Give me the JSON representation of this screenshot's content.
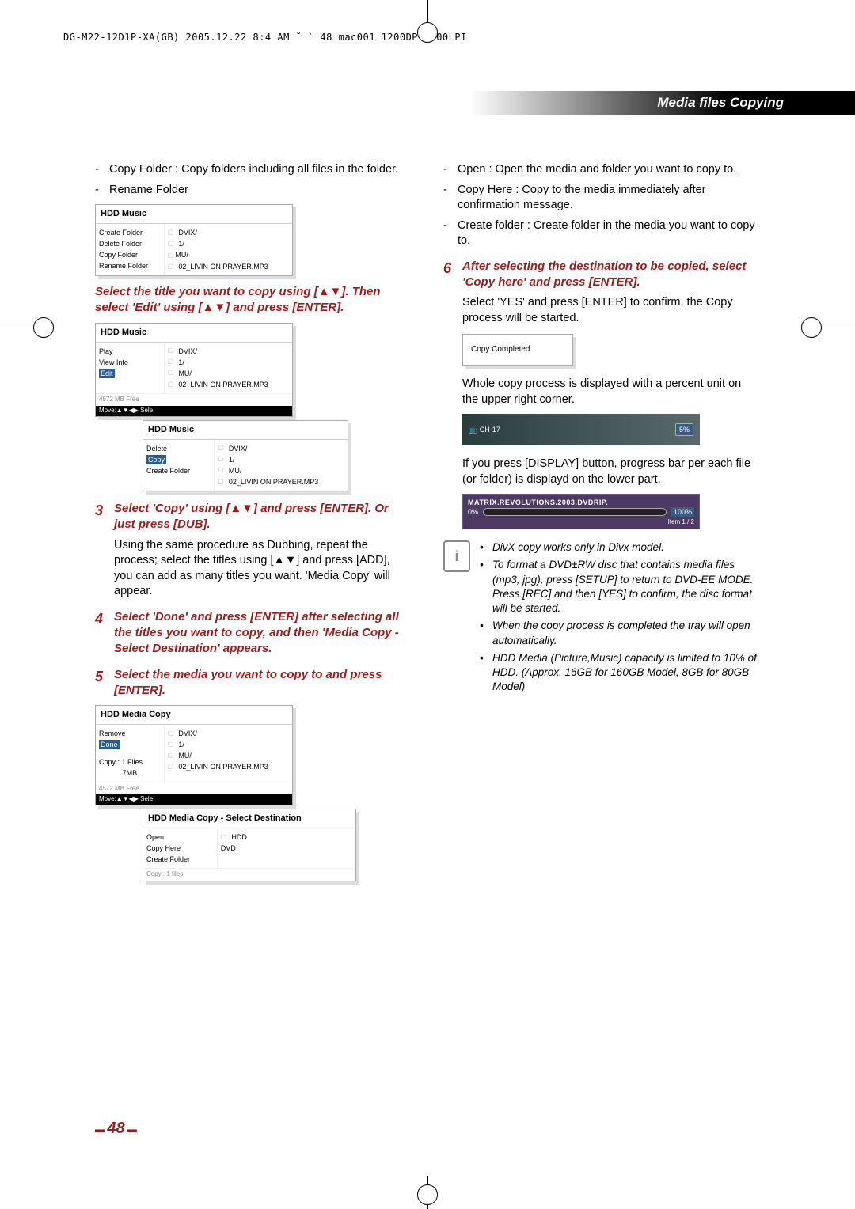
{
  "header_line": "DG-M22-12D1P-XA(GB)  2005.12.22 8:4 AM  ˘ ` 48   mac001  1200DPI 100LPI",
  "section_title": "Media files Copying",
  "left": {
    "b1": "Copy Folder : Copy folders including all files in the folder.",
    "b2": "Rename Folder",
    "ss1": {
      "title": "HDD Music",
      "menu": [
        "Create Folder",
        "Delete Folder",
        "Copy Folder",
        "Rename Folder"
      ],
      "hl": "MU/",
      "files": [
        "DVIX/",
        "1/",
        "MU/",
        "02_LIVIN ON PRAYER.MP3"
      ]
    },
    "emph1": "Select the title you want to copy using [▲▼]. Then select 'Edit' using  [▲▼] and press [ENTER].",
    "ss2": {
      "title": "HDD Music",
      "menu": [
        "Play",
        "View Info",
        "Edit"
      ],
      "hl": "Edit",
      "files": [
        "DVIX/",
        "1/",
        "MU/",
        "02_LIVIN ON PRAYER.MP3"
      ],
      "free": "4572 MB Free",
      "foot": "Move:▲▼◀▶  Sele"
    },
    "ss2b": {
      "title": "HDD Music",
      "menu": [
        "Delete",
        "Copy",
        "Create Folder"
      ],
      "hl": "Copy",
      "files": [
        "DVIX/",
        "1/",
        "MU/",
        "02_LIVIN ON PRAYER.MP3"
      ]
    },
    "step3": "Select 'Copy' using  [▲▼] and press [ENTER]. Or just press [DUB].",
    "p3": "Using the same procedure as Dubbing, repeat the process; select the titles using [▲▼] and press [ADD], you can add as many titles you want. 'Media Copy' will appear.",
    "step4": "Select 'Done' and press [ENTER] after selecting all the titles you want to copy, and then 'Media Copy - Select Destination' appears.",
    "step5": "Select the media you want to copy to and press [ENTER].",
    "ss3": {
      "title": "HDD Media Copy",
      "menu": [
        "Remove",
        "Done"
      ],
      "hl": "Done",
      "files": [
        "DVIX/",
        "1/",
        "MU/",
        "02_LIVIN ON PRAYER.MP3"
      ],
      "copy": "Copy : 1 Files",
      "size": "7MB",
      "free": "4572 MB Free",
      "foot": "Move:▲▼◀▶  Sele"
    },
    "ss3b": {
      "title": "HDD Media Copy - Select Destination",
      "menu": [
        "Open",
        "Copy Here",
        "Create Folder"
      ],
      "dest": [
        "HDD",
        "DVD"
      ],
      "hl": "DVD",
      "copy": "Copy : 1 files"
    }
  },
  "right": {
    "b1": "Open : Open the media and folder you want to copy to.",
    "b2": "Copy Here : Copy to the media immediately after confirmation message.",
    "b3": "Create folder : Create folder in the media you want to copy to.",
    "step6": "After selecting the destination to be copied, select 'Copy here' and press [ENTER].",
    "p6": "Select 'YES' and press [ENTER] to confirm, the Copy process will be started.",
    "dialog": "Copy Completed",
    "p7": "Whole copy process is displayed with a percent unit on the upper right corner.",
    "prog1": {
      "ch": "CH-17",
      "pct": "5%"
    },
    "p8": "If you press [DISPLAY] button, progress bar per each file (or folder) is displayd on the lower part.",
    "prog2": {
      "name": "MATRIX.REVOLUTIONS.2003.DVDRIP.",
      "pct_left": "0%",
      "pct_right": "100%",
      "item": "Item 1 / 2"
    },
    "notes": {
      "n1": "DivX copy works only in Divx model.",
      "n2": "To format a DVD±RW disc that contains media files (mp3, jpg), press [SETUP] to return to DVD-EE MODE. Press [REC] and then [YES] to confirm, the disc format will be started.",
      "n3": "When the copy process is completed the tray will open automatically.",
      "n4": "HDD Media (Picture,Music) capacity is limited to 10% of HDD. (Approx. 16GB for 160GB Model, 8GB for 80GB Model)"
    }
  },
  "page_number": "48"
}
